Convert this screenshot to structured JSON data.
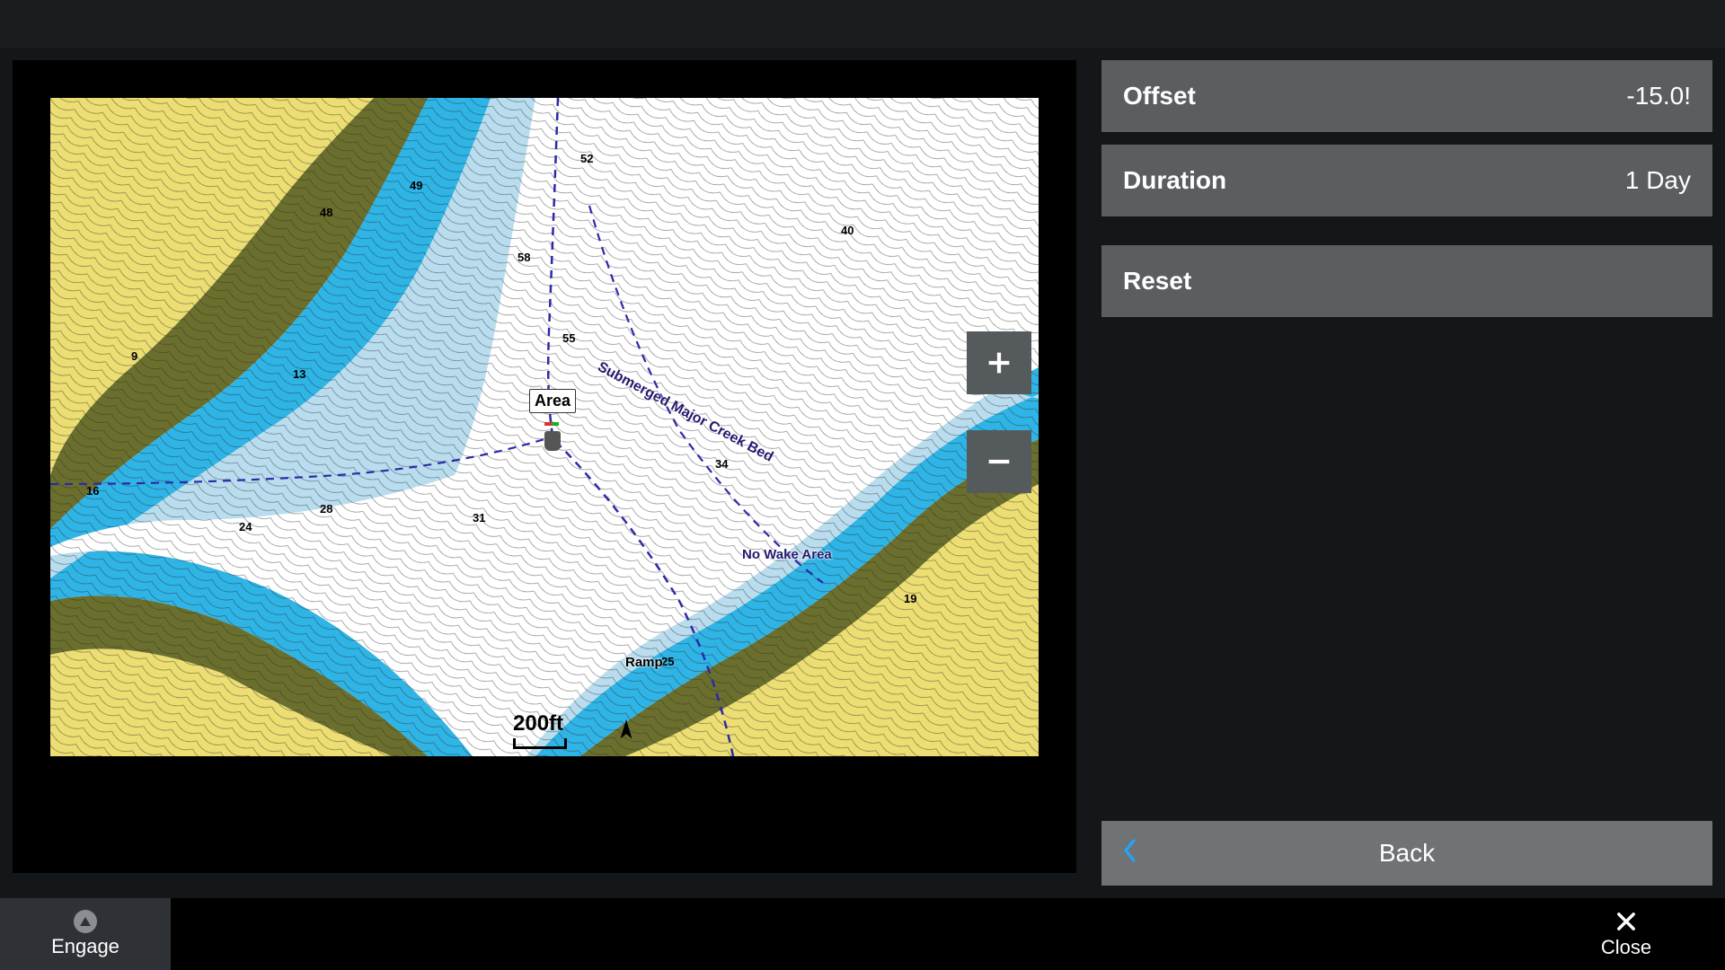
{
  "side_panel": {
    "offset": {
      "label": "Offset",
      "value": "-15.0!"
    },
    "duration": {
      "label": "Duration",
      "value": "1 Day"
    },
    "reset": {
      "label": "Reset"
    },
    "back": {
      "label": "Back"
    }
  },
  "bottom_bar": {
    "engage": "Engage",
    "close": "Close"
  },
  "map": {
    "scale": "200ft",
    "area_label": "Area",
    "labels": {
      "creek": "Submerged Major Creek Bed",
      "no_wake": "No Wake Area",
      "ramp": "Ramp"
    },
    "zoom_in": "+",
    "zoom_out": "−",
    "depth_samples": [
      "9",
      "13",
      "16",
      "24",
      "28",
      "31",
      "34",
      "40",
      "48",
      "49",
      "52",
      "55",
      "58",
      "19",
      "25"
    ]
  }
}
